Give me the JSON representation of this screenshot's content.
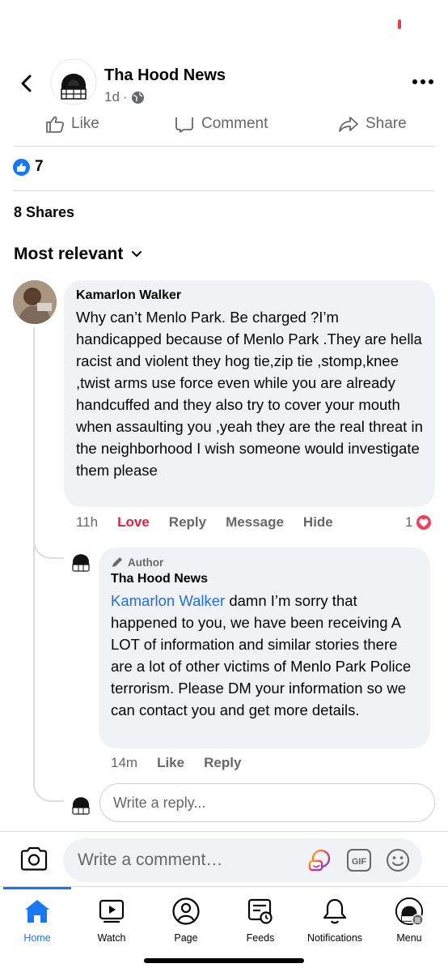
{
  "header": {
    "page_name": "Tha Hood News",
    "post_time": "1d",
    "dot": "·"
  },
  "actions": {
    "like": "Like",
    "comment": "Comment",
    "share": "Share"
  },
  "reactions": {
    "count": "7"
  },
  "shares": "8 Shares",
  "sort_label": "Most relevant",
  "comments": [
    {
      "author": "Kamarlon Walker",
      "text": "Why can’t Menlo Park.     Be charged ?I’m handicapped  because of Menlo Park .They are hella racist and violent they hog tie,zip tie ,stomp,knee ,twist arms use force even while you are already handcuffed and they also try to cover your mouth when assaulting you ,yeah they are the real threat in the neighborhood I wish someone would investigate them please",
      "time": "11h",
      "love": "Love",
      "reply": "Reply",
      "message": "Message",
      "hide": "Hide",
      "reaction_count": "1"
    }
  ],
  "reply": {
    "badge": "Author",
    "author": "Tha Hood News",
    "mention": "Kamarlon Walker",
    "text": " damn I’m sorry that happened to you, we have been receiving A LOT of information and similar stories there are a lot of other victims of Menlo Park Police terrorism. Please DM your information so we can contact you and get more details.",
    "time": "14m",
    "like": "Like",
    "reply": "Reply"
  },
  "reply_input": {
    "placeholder": "Write a reply..."
  },
  "composer": {
    "placeholder": "Write a comment…",
    "gif_label": "GIF"
  },
  "nav": [
    {
      "label": "Home",
      "icon": "home-icon"
    },
    {
      "label": "Watch",
      "icon": "watch-icon"
    },
    {
      "label": "Page",
      "icon": "page-icon"
    },
    {
      "label": "Feeds",
      "icon": "feeds-icon"
    },
    {
      "label": "Notifications",
      "icon": "bell-icon"
    },
    {
      "label": "Menu",
      "icon": "menu-icon"
    }
  ],
  "colors": {
    "accent": "#1877f2",
    "love": "#e41e3f",
    "bubble": "#f0f2f5",
    "secondary_text": "#65676b"
  }
}
